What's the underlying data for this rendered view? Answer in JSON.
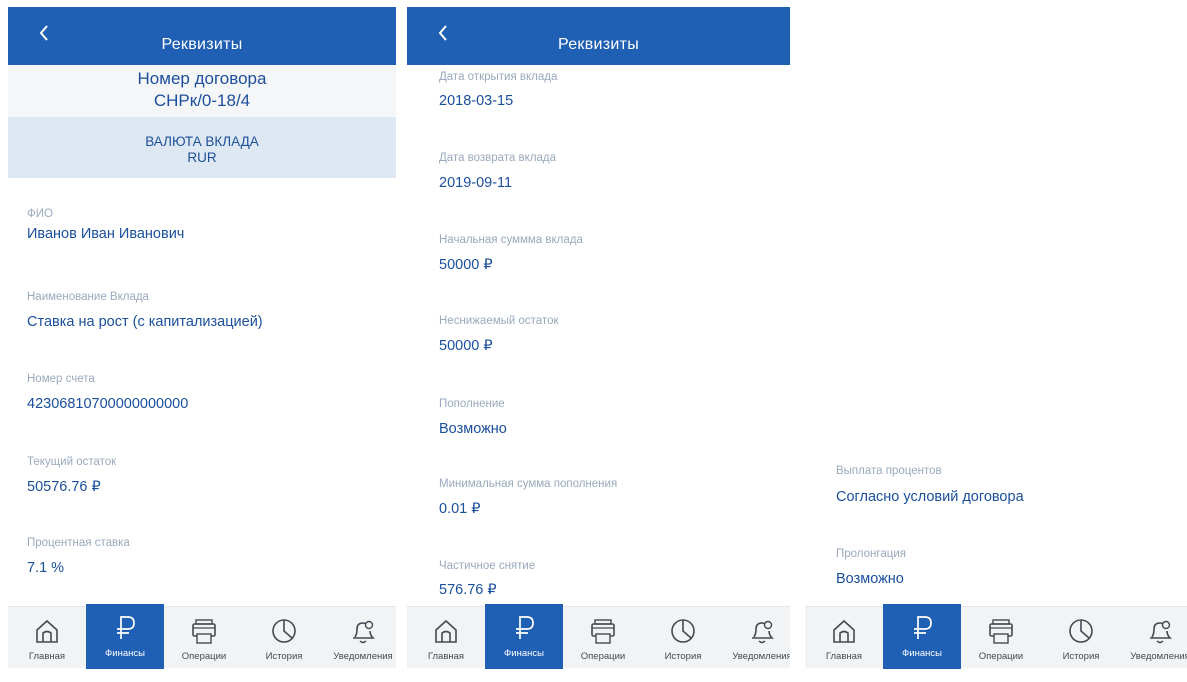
{
  "colors": {
    "brand": "#1f5fb4",
    "value_text": "#1a4f9c",
    "label_text": "#9aa9bd",
    "currency_band": "#dde8f2"
  },
  "header": {
    "title": "Реквизиты",
    "back_icon": "chevron-left-icon"
  },
  "contract": {
    "title": "Номер договора",
    "number": "СНРк/0-18/4"
  },
  "currency": {
    "label": "ВАЛЮТА ВКЛАДА",
    "value": "RUR"
  },
  "screen1": {
    "fields": [
      {
        "label": "ФИО",
        "value": "Иванов Иван Иванович"
      },
      {
        "label": "Наименование Вклада",
        "value": "Ставка на рост (с капитализацией)"
      },
      {
        "label": "Номер счета",
        "value": "42306810700000000000"
      },
      {
        "label": "Текущий остаток",
        "value": "50576.76 ₽"
      },
      {
        "label": "Процентная ставка",
        "value": "7.1 %"
      }
    ]
  },
  "screen2": {
    "fields": [
      {
        "label": "Дата открытия вклада",
        "value": "2018-03-15"
      },
      {
        "label": "Дата возврата вклада",
        "value": "2019-09-11"
      },
      {
        "label": "Начальная суммма вклада",
        "value": "50000 ₽"
      },
      {
        "label": "Неснижаемый остаток",
        "value": "50000 ₽"
      },
      {
        "label": "Пополнение",
        "value": "Возможно"
      },
      {
        "label": "Минимальная сумма пополнения",
        "value": "0.01 ₽"
      },
      {
        "label": "Частичное снятие",
        "value": "576.76 ₽"
      }
    ]
  },
  "screen3": {
    "fields": [
      {
        "label": "Выплата процентов",
        "value": "Согласно условий договора"
      },
      {
        "label": "Пролонгация",
        "value": "Возможно"
      }
    ]
  },
  "tabbar": {
    "active": "Финансы",
    "items": [
      {
        "label": "Главная",
        "icon": "home-icon"
      },
      {
        "label": "Финансы",
        "icon": "ruble-icon"
      },
      {
        "label": "Операции",
        "icon": "printer-icon"
      },
      {
        "label": "История",
        "icon": "pie-chart-icon"
      },
      {
        "label": "Уведомления",
        "icon": "bell-icon"
      }
    ]
  }
}
